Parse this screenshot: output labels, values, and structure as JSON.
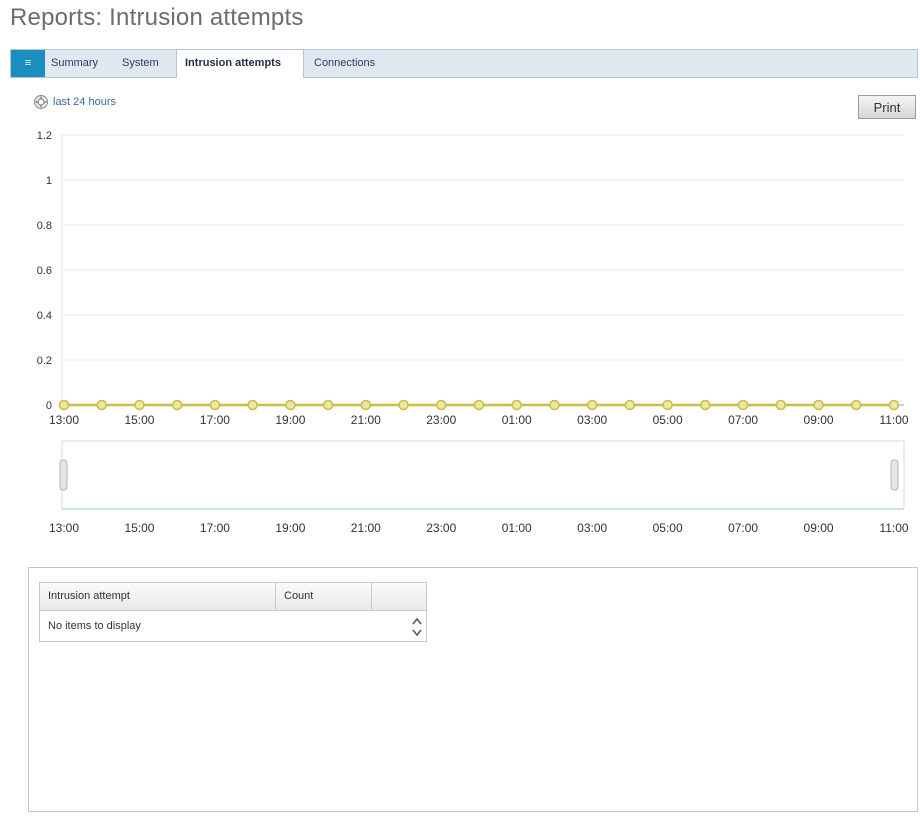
{
  "page": {
    "title": "Reports: Intrusion attempts"
  },
  "tabs": [
    {
      "label": "",
      "icon": "home-icon"
    },
    {
      "label": "Summary"
    },
    {
      "label": "System"
    },
    {
      "label": "Intrusion attempts",
      "active": true
    },
    {
      "label": "Connections"
    }
  ],
  "toolbar": {
    "period_label": "last 24 hours",
    "print_label": "Print"
  },
  "chart_data": {
    "type": "line",
    "x": [
      "13:00",
      "14:00",
      "15:00",
      "16:00",
      "17:00",
      "18:00",
      "19:00",
      "20:00",
      "21:00",
      "22:00",
      "23:00",
      "00:00",
      "01:00",
      "02:00",
      "03:00",
      "04:00",
      "05:00",
      "06:00",
      "07:00",
      "08:00",
      "09:00",
      "10:00",
      "11:00"
    ],
    "xticks": [
      "13:00",
      "15:00",
      "17:00",
      "19:00",
      "21:00",
      "23:00",
      "01:00",
      "03:00",
      "05:00",
      "07:00",
      "09:00",
      "11:00"
    ],
    "series": [
      {
        "values": [
          0,
          0,
          0,
          0,
          0,
          0,
          0,
          0,
          0,
          0,
          0,
          0,
          0,
          0,
          0,
          0,
          0,
          0,
          0,
          0,
          0,
          0,
          0
        ],
        "color": "#c9bd45"
      }
    ],
    "ylim": [
      0,
      1.2
    ],
    "yticks": [
      "1.2",
      "1",
      "0.8",
      "0.6",
      "0.4",
      "0.2",
      "0"
    ],
    "grid": true,
    "navigator": {
      "xticks": [
        "13:00",
        "15:00",
        "17:00",
        "19:00",
        "21:00",
        "23:00",
        "01:00",
        "03:00",
        "05:00",
        "07:00",
        "09:00",
        "11:00"
      ]
    }
  },
  "table": {
    "columns": [
      "Intrusion attempt",
      "Count",
      ""
    ],
    "empty_text": "No items to display"
  }
}
